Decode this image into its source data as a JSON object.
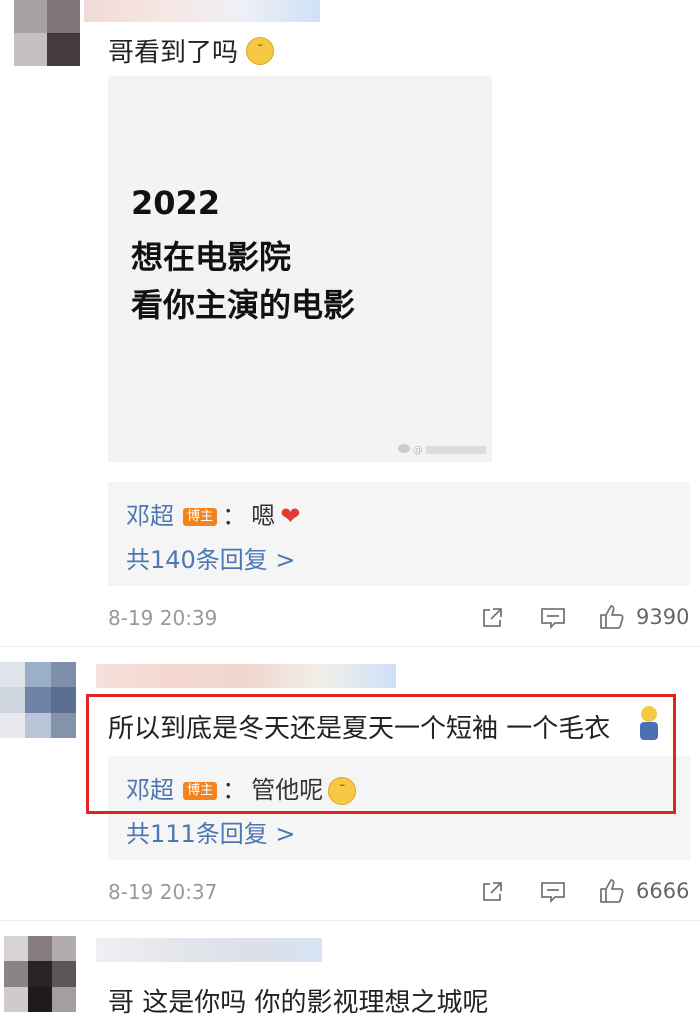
{
  "comments": [
    {
      "text": "哥看到了吗",
      "emoji_icon": "smirk-emoji-icon",
      "image_lines": [
        "2022",
        "想在电影院",
        "看你主演的电影"
      ],
      "image_watermark": "@",
      "reply": {
        "author": "邓超",
        "badge": "博主",
        "separator": "：",
        "text": "嗯",
        "emoji": "❤"
      },
      "more_replies": "共140条回复 >",
      "time": "8-19 20:39",
      "likes": "9390"
    },
    {
      "text": "所以到底是冬天还是夏天一个短袖 一个毛衣",
      "reply": {
        "author": "邓超",
        "badge": "博主",
        "separator": "：",
        "text": "管他呢"
      },
      "more_replies": "共111条回复 >",
      "time": "8-19 20:37",
      "likes": "6666"
    },
    {
      "text": "哥 这是你吗 你的影视理想之城呢"
    }
  ],
  "colors": {
    "link": "#4d77b2",
    "highlight": "#e02424",
    "badge": "#f2831e"
  }
}
